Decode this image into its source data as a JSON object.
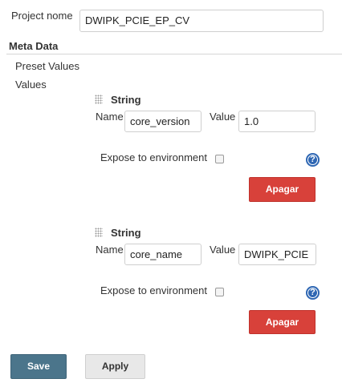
{
  "project": {
    "label": "Project nome",
    "value": "DWIPK_PCIE_EP_CV"
  },
  "meta_data": {
    "heading": "Meta Data",
    "preset_values": "Preset Values",
    "values": "Values"
  },
  "entries": [
    {
      "type": "String",
      "name_label": "Name",
      "name_value": "core_version",
      "value_label": "Value",
      "value_value": "1.0",
      "expose_label": "Expose to environment",
      "expose_checked": false,
      "help": "?",
      "delete_label": "Apagar"
    },
    {
      "type": "String",
      "name_label": "Name",
      "name_value": "core_name",
      "value_label": "Value",
      "value_value": "DWIPK_PCIE",
      "expose_label": "Expose to environment",
      "expose_checked": false,
      "help": "?",
      "delete_label": "Apagar"
    }
  ],
  "buttons": {
    "save": "Save",
    "apply": "Apply"
  },
  "colors": {
    "delete": "#d8413a",
    "save": "#4b758b",
    "apply": "#e8e8e8",
    "help": "#2f67b3"
  }
}
